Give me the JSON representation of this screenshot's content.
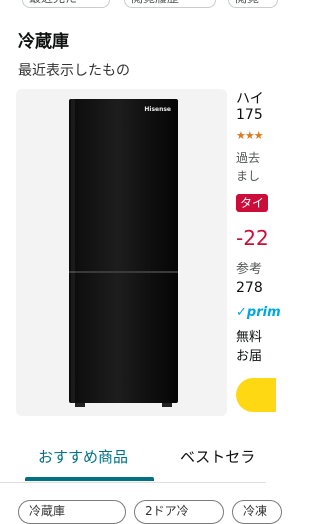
{
  "top_chips": [
    {
      "label": "最近見た"
    },
    {
      "label": "閲覧履歴"
    },
    {
      "label": "閲覧"
    }
  ],
  "section": {
    "title": "冷蔵庫",
    "subtitle": "最近表示したもの"
  },
  "product": {
    "brand_on_image": "Hisense",
    "title_partial": "ハイ",
    "capacity_partial": "175",
    "rating_stars": "★★★",
    "sales_line1": "過去",
    "sales_line2": "まし",
    "deal_badge": "タイ",
    "price_partial": "-22",
    "ref_label": "参考",
    "ref_price_partial": "278",
    "prime_label": "✓prim",
    "shipping_line1": "無料",
    "shipping_line2": "お届"
  },
  "tabs": [
    {
      "label": "おすすめ商品",
      "active": true
    },
    {
      "label": "ベストセラ",
      "active": false
    }
  ],
  "bottom_chips": [
    {
      "label": "冷蔵庫"
    },
    {
      "label": "2ドア冷"
    },
    {
      "label": "冷凍"
    }
  ],
  "colors": {
    "accent": "#007185",
    "deal_red": "#cc0c39",
    "prime_blue": "#00a8e1",
    "cart_yellow": "#ffd814"
  }
}
